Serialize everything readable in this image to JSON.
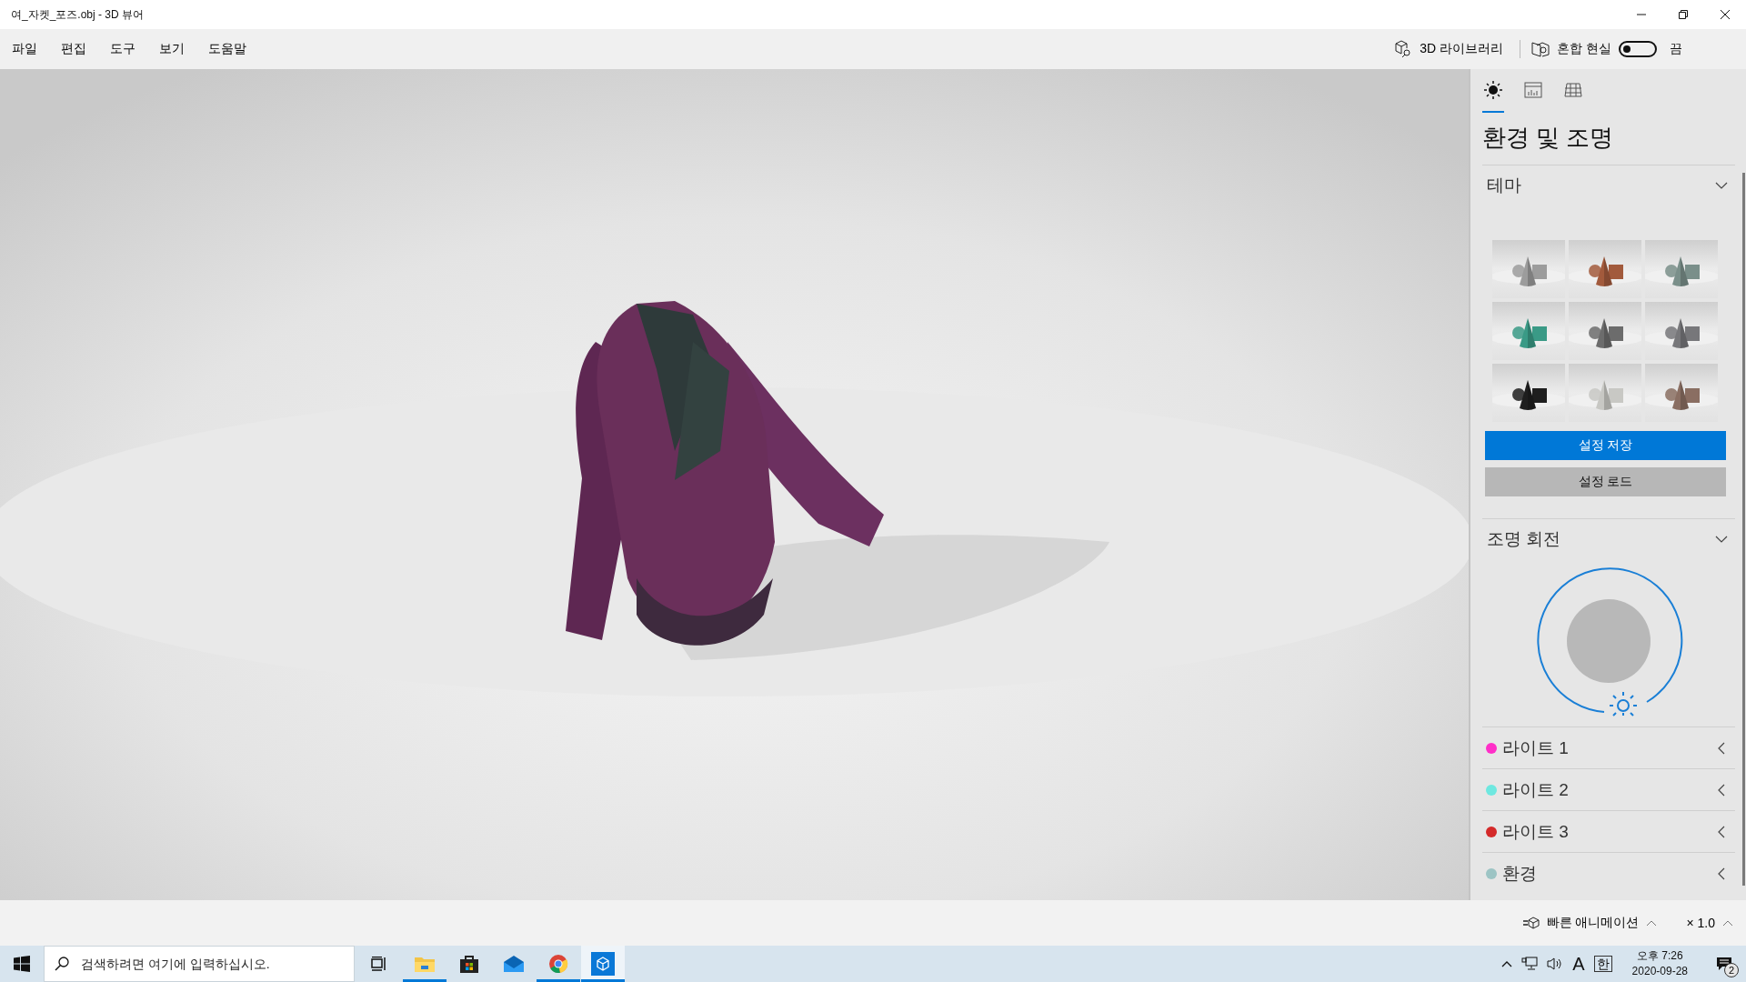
{
  "window": {
    "title": "여_자켓_포즈.obj - 3D 뷰어"
  },
  "menu": [
    "파일",
    "편집",
    "도구",
    "보기",
    "도움말"
  ],
  "toolbar": {
    "library": "3D 라이브러리",
    "mixed_reality": {
      "label": "혼합 현실",
      "on": false,
      "state_label": "끔"
    }
  },
  "panel": {
    "tabs": [
      {
        "kind": "lighting",
        "selected": true
      },
      {
        "kind": "stats",
        "selected": false
      },
      {
        "kind": "grid",
        "selected": false
      }
    ],
    "title": "환경 및 조명",
    "theme_section": {
      "title": "테마",
      "expanded": true,
      "themes": [
        {
          "color": "#9c9c9c"
        },
        {
          "color": "#a25a3c"
        },
        {
          "color": "#7a8f8a"
        },
        {
          "color": "#3a9a86"
        },
        {
          "color": "#6c6c6c"
        },
        {
          "color": "#77777a"
        },
        {
          "color": "#1e1e1e"
        },
        {
          "color": "#c8c8c4"
        },
        {
          "color": "#8a6e62"
        }
      ],
      "buttons": [
        {
          "label": "설정 저장",
          "kind": "primary"
        },
        {
          "label": "설정 로드",
          "kind": "secondary"
        }
      ]
    },
    "rotation_section": {
      "title": "조명 회전",
      "expanded": true
    },
    "lights": [
      {
        "name": "라이트 1",
        "color": "#ff2fc8",
        "expanded": false
      },
      {
        "name": "라이트 2",
        "color": "#6ee8e0",
        "expanded": false
      },
      {
        "name": "라이트 3",
        "color": "#d42a2a",
        "expanded": false
      },
      {
        "name": "환경",
        "color": "#9cc4c4",
        "expanded": false
      }
    ]
  },
  "animation_bar": {
    "animation": "빠른 애니메이션",
    "speed": "× 1.0"
  },
  "taskbar": {
    "search_placeholder": "검색하려면 여기에 입력하십시오.",
    "apps": [
      {
        "kind": "folder",
        "running": true,
        "selected": false
      },
      {
        "kind": "store",
        "running": false,
        "selected": false
      },
      {
        "kind": "mail",
        "running": false,
        "selected": false
      },
      {
        "kind": "browser",
        "running": true,
        "selected": false
      },
      {
        "kind": "cube",
        "running": true,
        "selected": true
      }
    ],
    "tray": {
      "keyboard": "A",
      "ime": "한",
      "time": "오후 7:26",
      "date": "2020-09-28",
      "notifications": "2"
    }
  }
}
